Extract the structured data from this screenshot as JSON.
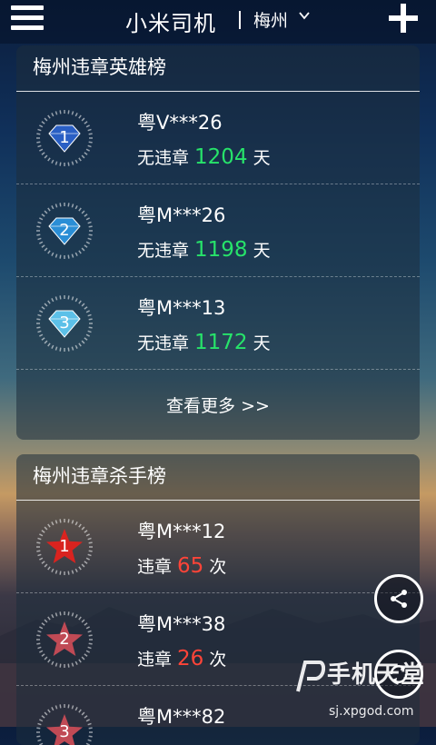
{
  "header": {
    "app_title": "小米司机",
    "city": "梅州"
  },
  "hero_board": {
    "title": "梅州违章英雄榜",
    "items": [
      {
        "rank": "1",
        "plate": "粤V***26",
        "prefix": "无违章",
        "value": "1204",
        "suffix": "天",
        "color": "#2a5fc4"
      },
      {
        "rank": "2",
        "plate": "粤M***26",
        "prefix": "无违章",
        "value": "1198",
        "suffix": "天",
        "color": "#2a8ed6"
      },
      {
        "rank": "3",
        "plate": "粤M***13",
        "prefix": "无违章",
        "value": "1172",
        "suffix": "天",
        "color": "#5cc0e8"
      }
    ],
    "more_label": "查看更多 >>"
  },
  "killer_board": {
    "title": "梅州违章杀手榜",
    "items": [
      {
        "rank": "1",
        "plate": "粤M***12",
        "prefix": "违章",
        "value": "65",
        "suffix": "次",
        "color": "#d9231f"
      },
      {
        "rank": "2",
        "plate": "粤M***38",
        "prefix": "违章",
        "value": "26",
        "suffix": "次",
        "color": "#c04a55"
      },
      {
        "rank": "3",
        "plate": "粤M***82",
        "prefix": "",
        "value": "",
        "suffix": "",
        "color": "#c04a55"
      }
    ]
  },
  "watermark": {
    "brand": "手机天堂",
    "url": "sj.xpgod.com"
  }
}
